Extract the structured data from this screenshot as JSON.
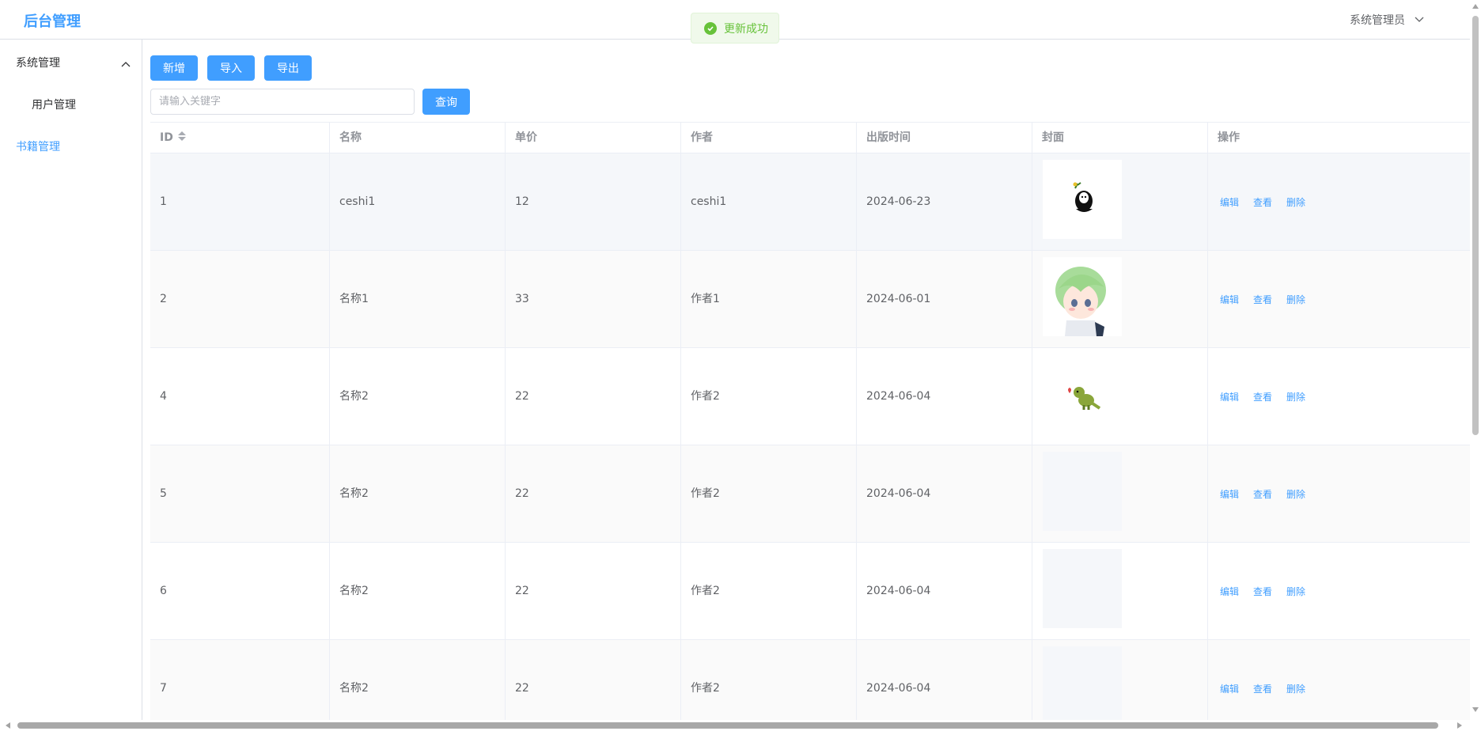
{
  "header": {
    "brand": "后台管理",
    "user_name": "系统管理员"
  },
  "toast": {
    "message": "更新成功"
  },
  "sidebar": {
    "group_label": "系统管理",
    "sub_items": [
      {
        "label": "用户管理"
      }
    ],
    "books_label": "书籍管理"
  },
  "toolbar": {
    "add_label": "新增",
    "import_label": "导入",
    "export_label": "导出"
  },
  "search": {
    "placeholder": "请输入关键字",
    "value": "",
    "button_label": "查询"
  },
  "table": {
    "columns": [
      "ID",
      "名称",
      "单价",
      "作者",
      "出版时间",
      "封面",
      "操作"
    ],
    "actions": [
      "编辑",
      "查看",
      "删除"
    ],
    "rows": [
      {
        "id": "1",
        "name": "ceshi1",
        "price": "12",
        "author": "ceshi1",
        "date": "2024-06-23",
        "cover": "ghost-sticker"
      },
      {
        "id": "2",
        "name": "名称1",
        "price": "33",
        "author": "作者1",
        "date": "2024-06-01",
        "cover": "green-hair-boy"
      },
      {
        "id": "4",
        "name": "名称2",
        "price": "22",
        "author": "作者2",
        "date": "2024-06-04",
        "cover": "dinosaur-sticker"
      },
      {
        "id": "5",
        "name": "名称2",
        "price": "22",
        "author": "作者2",
        "date": "2024-06-04",
        "cover": "empty"
      },
      {
        "id": "6",
        "name": "名称2",
        "price": "22",
        "author": "作者2",
        "date": "2024-06-04",
        "cover": "empty"
      },
      {
        "id": "7",
        "name": "名称2",
        "price": "22",
        "author": "作者2",
        "date": "2024-06-04",
        "cover": "empty"
      }
    ]
  },
  "colors": {
    "primary": "#409eff",
    "success": "#67c23a",
    "header_text": "#909399"
  }
}
